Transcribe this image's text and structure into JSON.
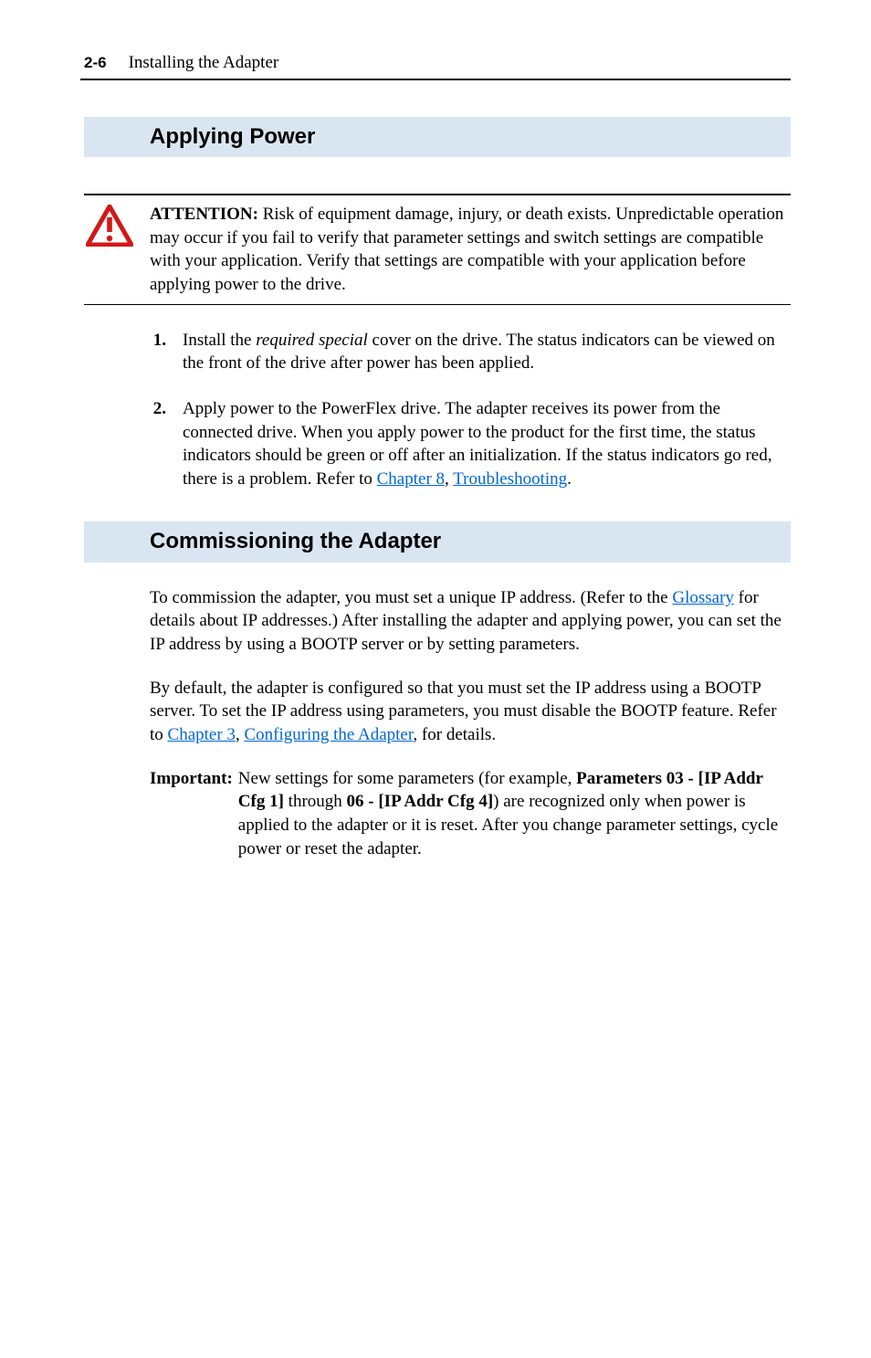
{
  "header": {
    "page_number": "2-6",
    "title": "Installing the Adapter"
  },
  "section1": {
    "heading": "Applying Power",
    "attention": {
      "label": "ATTENTION:",
      "text": "Risk of equipment damage, injury, or death exists. Unpredictable operation may occur if you fail to verify that parameter settings and switch settings are compatible with your application. Verify that settings are compatible with your application before applying power to the drive."
    },
    "steps": [
      {
        "num": "1.",
        "pre": "Install the ",
        "em": "required special",
        "post": " cover on the drive. The status indicators can be viewed on the front of the drive after power has been applied."
      },
      {
        "num": "2.",
        "pre": "Apply power to the PowerFlex drive. The adapter receives its power from the connected drive. When you apply power to the product for the first time, the status indicators should be green or off after an initialization. If the status indicators go red, there is a problem. Refer to ",
        "link1": "Chapter 8",
        "mid": ", ",
        "link2": "Troubleshooting",
        "post": "."
      }
    ]
  },
  "section2": {
    "heading": "Commissioning the Adapter",
    "para1": {
      "pre": "To commission the adapter, you must set a unique IP address. (Refer to the ",
      "link": "Glossary",
      "post": " for details about IP addresses.) After installing the adapter and applying power, you can set the IP address by using a BOOTP server or by setting parameters."
    },
    "para2": {
      "pre": "By default, the adapter is configured so that you must set the IP address using a BOOTP server. To set the IP address using parameters, you must disable the BOOTP feature. Refer to ",
      "link1": "Chapter 3",
      "mid": ", ",
      "link2": "Configuring the Adapter",
      "post": ", for details."
    },
    "important": {
      "label": "Important:",
      "line1_pre": "New settings for some parameters (for example, ",
      "bold1": "Parameters 03 - [IP Addr Cfg 1]",
      "mid1": " through ",
      "bold2": "06 - [IP Addr Cfg 4]",
      "line1_post": ") are recognized only when power is applied to the adapter or it is reset. After you change parameter settings, cycle power or reset the adapter."
    }
  }
}
